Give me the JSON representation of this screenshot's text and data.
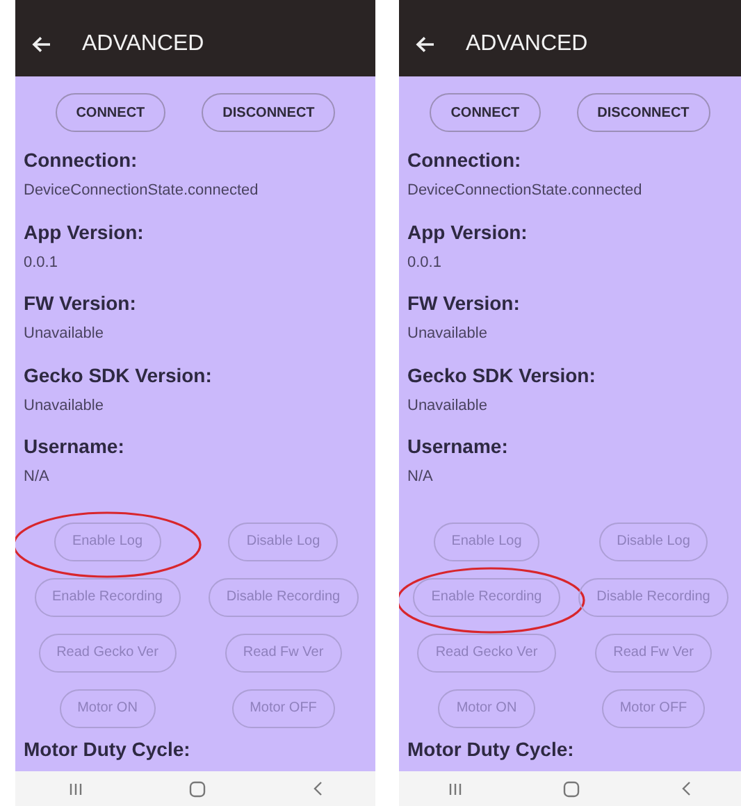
{
  "phones": [
    {
      "title": "ADVANCED",
      "top_buttons": [
        {
          "label": "CONNECT",
          "disabled": false
        },
        {
          "label": "DISCONNECT",
          "disabled": false
        }
      ],
      "fields": [
        {
          "label": "Connection:",
          "value": "DeviceConnectionState.connected"
        },
        {
          "label": "App Version:",
          "value": "0.0.1"
        },
        {
          "label": "FW Version:",
          "value": "Unavailable"
        },
        {
          "label": "Gecko SDK Version:",
          "value": "Unavailable"
        },
        {
          "label": "Username:",
          "value": "N/A"
        }
      ],
      "control_buttons": [
        {
          "label": "Enable Log",
          "disabled": true,
          "circled": true
        },
        {
          "label": "Disable Log",
          "disabled": true,
          "circled": false
        },
        {
          "label": "Enable Recording",
          "disabled": true,
          "circled": false
        },
        {
          "label": "Disable Recording",
          "disabled": true,
          "circled": false
        },
        {
          "label": "Read Gecko Ver",
          "disabled": true,
          "circled": false
        },
        {
          "label": "Read Fw Ver",
          "disabled": true,
          "circled": false
        },
        {
          "label": "Motor ON",
          "disabled": true,
          "circled": false
        },
        {
          "label": "Motor OFF",
          "disabled": true,
          "circled": false
        }
      ],
      "next_label": "Motor Duty Cycle:"
    },
    {
      "title": "ADVANCED",
      "top_buttons": [
        {
          "label": "CONNECT",
          "disabled": false
        },
        {
          "label": "DISCONNECT",
          "disabled": false
        }
      ],
      "fields": [
        {
          "label": "Connection:",
          "value": "DeviceConnectionState.connected"
        },
        {
          "label": "App Version:",
          "value": "0.0.1"
        },
        {
          "label": "FW Version:",
          "value": "Unavailable"
        },
        {
          "label": "Gecko SDK Version:",
          "value": "Unavailable"
        },
        {
          "label": "Username:",
          "value": "N/A"
        }
      ],
      "control_buttons": [
        {
          "label": "Enable Log",
          "disabled": true,
          "circled": false
        },
        {
          "label": "Disable Log",
          "disabled": true,
          "circled": false
        },
        {
          "label": "Enable Recording",
          "disabled": true,
          "circled": true
        },
        {
          "label": "Disable Recording",
          "disabled": true,
          "circled": false
        },
        {
          "label": "Read Gecko Ver",
          "disabled": true,
          "circled": false
        },
        {
          "label": "Read Fw Ver",
          "disabled": true,
          "circled": false
        },
        {
          "label": "Motor ON",
          "disabled": true,
          "circled": false
        },
        {
          "label": "Motor OFF",
          "disabled": true,
          "circled": false
        }
      ],
      "next_label": "Motor Duty Cycle:"
    }
  ]
}
